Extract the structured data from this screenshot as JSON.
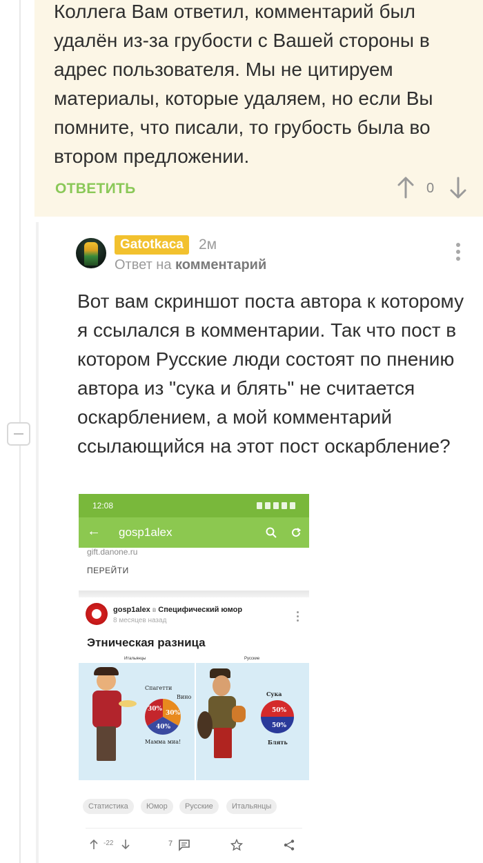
{
  "parent_comment": {
    "text": "Коллега Вам ответил, комментарий был удалён из-за грубости с Вашей стороны в адрес пользователя. Мы не цитируем материалы, которые удаляем, но если Вы помните, что писали, то грубость была во втором предложении.",
    "reply_label": "ОТВЕТИТЬ",
    "rating": "0"
  },
  "reply_comment": {
    "author": "Gatotkaca",
    "time": "2м",
    "reply_to_prefix": "Ответ на",
    "reply_to_link": "комментарий",
    "text": "Вот вам скриншот поста автора к которому я ссылался в комментарии. Так что пост в котором Русские люди состоят по пнению автора из \"сука и блять\" не считается оскарблением, а мой комментарий ссылающийся на этот пост оскарбление?"
  },
  "screenshot": {
    "status_time": "12:08",
    "app_bar_title": "gosp1alex",
    "ad_url": "gift.danone.ru",
    "ad_link": "ПЕРЕЙТИ",
    "post_author": "gosp1alex",
    "post_in": "в",
    "post_community": "Специфический юмор",
    "post_time": "8 месяцев назад",
    "post_title": "Этническая разница",
    "label_left": "Итальянцы",
    "label_right": "Русские",
    "left_pie_labels": [
      "Спагетти",
      "Вино",
      "Мамма миа!"
    ],
    "left_pie_values": [
      "30%",
      "30%",
      "40%"
    ],
    "right_pie_labels": [
      "Сука",
      "Блять"
    ],
    "right_pie_values": [
      "50%",
      "50%"
    ],
    "tags": [
      "Статистика",
      "Юмор",
      "Русские",
      "Итальянцы"
    ],
    "rating": "-22",
    "comments": "7"
  },
  "colors": {
    "parent_bg": "#fcf6e6",
    "accent_green": "#8ac858",
    "author_badge": "#f2c12e",
    "app_bar": "#8cc850"
  }
}
